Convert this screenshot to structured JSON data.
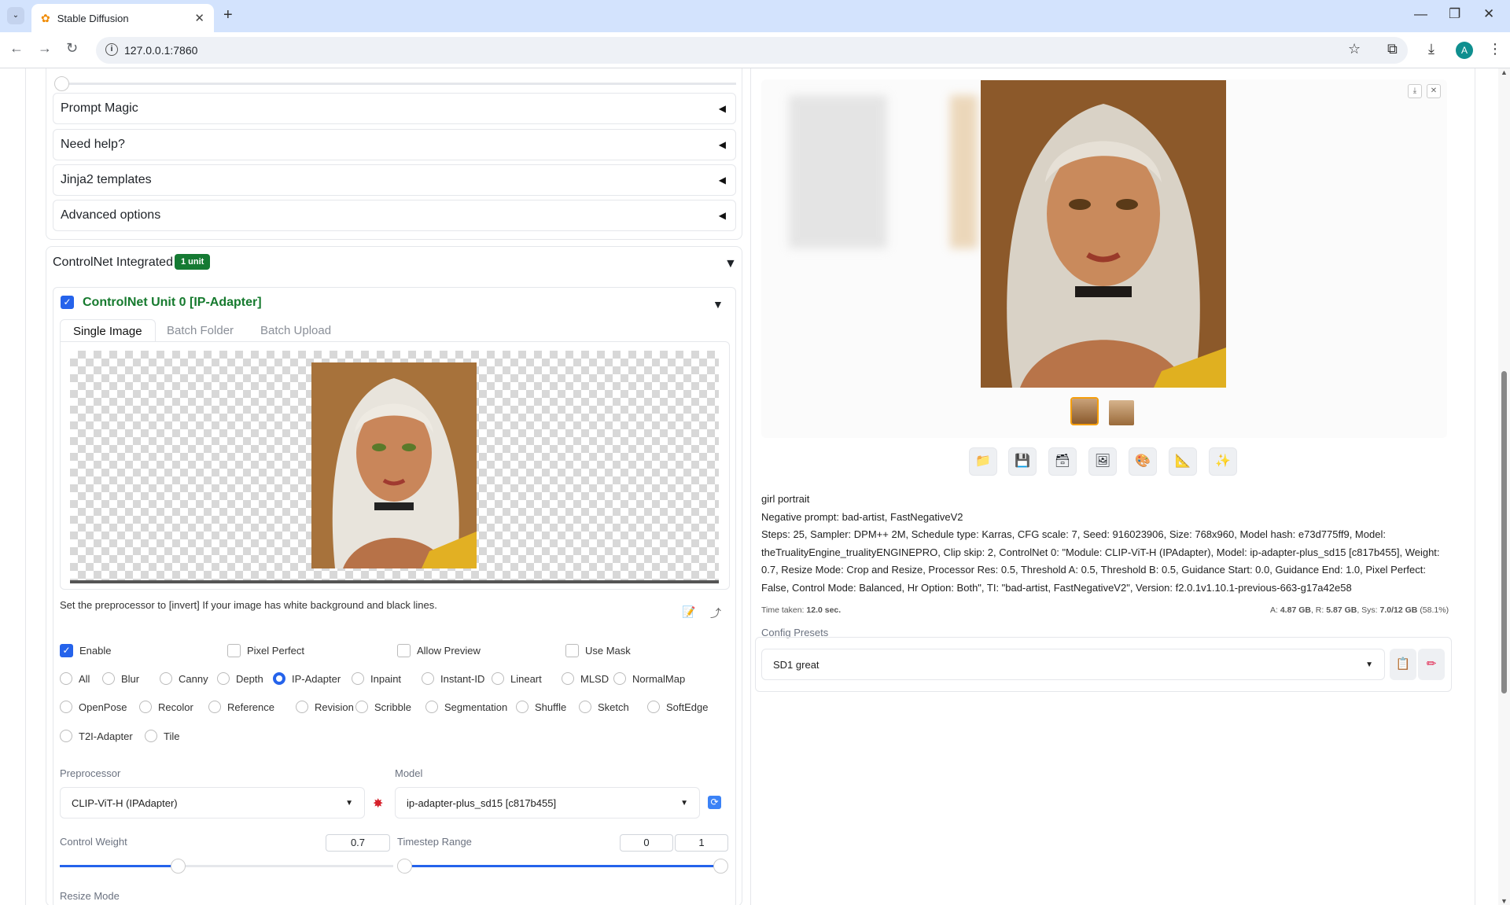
{
  "browser": {
    "tab_title": "Stable Diffusion",
    "url": "127.0.0.1:7860",
    "avatar_letter": "A"
  },
  "left": {
    "accordions": [
      "Prompt Magic",
      "Need help?",
      "Jinja2 templates",
      "Advanced options"
    ],
    "controlnet": {
      "title": "ControlNet Integrated",
      "badge": "1 unit",
      "unit_title": "ControlNet Unit 0 [IP-Adapter]",
      "tabs": [
        "Single Image",
        "Batch Folder",
        "Batch Upload"
      ],
      "tip": "Set the preprocessor to [invert] If your image has white background and black lines.",
      "checks": {
        "enable": "Enable",
        "pixel_perfect": "Pixel Perfect",
        "allow_preview": "Allow Preview",
        "use_mask": "Use Mask"
      },
      "control_types_row1": [
        "All",
        "Blur",
        "Canny",
        "Depth",
        "IP-Adapter",
        "Inpaint",
        "Instant-ID",
        "Lineart",
        "MLSD",
        "NormalMap"
      ],
      "control_types_row2": [
        "OpenPose",
        "Recolor",
        "Reference",
        "Revision",
        "Scribble",
        "Segmentation",
        "Shuffle",
        "Sketch",
        "SoftEdge"
      ],
      "control_types_row3": [
        "T2I-Adapter",
        "Tile"
      ],
      "selected_type": "IP-Adapter",
      "preprocessor_label": "Preprocessor",
      "preprocessor_value": "CLIP-ViT-H (IPAdapter)",
      "model_label": "Model",
      "model_value": "ip-adapter-plus_sd15 [c817b455]",
      "weight_label": "Control Weight",
      "weight_value": "0.7",
      "timestep_label": "Timestep Range",
      "timestep_start": "0",
      "timestep_end": "1",
      "resize_label": "Resize Mode"
    }
  },
  "right": {
    "prompt": "girl portrait",
    "negative": "Negative prompt: bad-artist, FastNegativeV2",
    "params": "Steps: 25, Sampler: DPM++ 2M, Schedule type: Karras, CFG scale: 7, Seed: 916023906, Size: 768x960, Model hash: e73d775ff9, Model: theTrualityEngine_trualityENGINEPRO, Clip skip: 2, ControlNet 0: \"Module: CLIP-ViT-H (IPAdapter), Model: ip-adapter-plus_sd15 [c817b455], Weight: 0.7, Resize Mode: Crop and Resize, Processor Res: 0.5, Threshold A: 0.5, Threshold B: 0.5, Guidance Start: 0.0, Guidance End: 1.0, Pixel Perfect: False, Control Mode: Balanced, Hr Option: Both\", TI: \"bad-artist, FastNegativeV2\", Version: f2.0.1v1.10.1-previous-663-g17a42e58",
    "time_label": "Time taken:",
    "time_value": "12.0 sec.",
    "perf_a_label": "A:",
    "perf_a_value": "4.87 GB",
    "perf_r_label": ", R:",
    "perf_r_value": "5.87 GB",
    "perf_sys_label": ", Sys:",
    "perf_sys_value": "7.0/12 GB",
    "perf_pct": "(58.1%)",
    "config_label": "Config Presets",
    "config_value": "SD1 great"
  }
}
